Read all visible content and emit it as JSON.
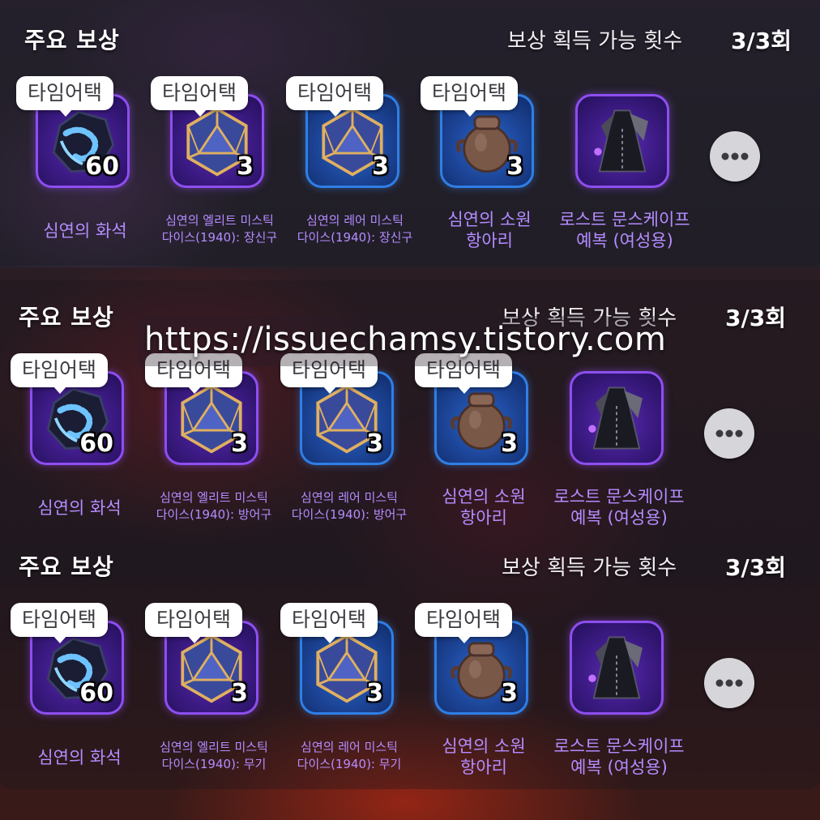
{
  "sections": [
    {
      "title": "주요 보상",
      "count_label": "보상 획득 가능 횟수",
      "count_value": "3/3회",
      "rewards": [
        {
          "badge": "타임어택",
          "quantity": "60",
          "name_lines": [
            "심연의 화석"
          ],
          "icon": "fossil-icon",
          "frame": "purple"
        },
        {
          "badge": "타임어택",
          "quantity": "3",
          "name_lines": [
            "심연의 엘리트 미스틱",
            "다이스(1940): 장신구"
          ],
          "icon": "dice-icon",
          "frame": "purple"
        },
        {
          "badge": "타임어택",
          "quantity": "3",
          "name_lines": [
            "심연의 레어 미스틱",
            "다이스(1940): 장신구"
          ],
          "icon": "dice-icon",
          "frame": "blue"
        },
        {
          "badge": "타임어택",
          "quantity": "3",
          "name_lines": [
            "심연의 소원",
            "항아리"
          ],
          "icon": "jar-icon",
          "frame": "blue"
        },
        {
          "badge": "",
          "quantity": "",
          "name_lines": [
            "로스트 문스케이프",
            "예복 (여성용)"
          ],
          "icon": "robe-icon",
          "frame": "purple"
        }
      ]
    },
    {
      "title": "주요 보상",
      "count_label": "보상 획득 가능 횟수",
      "count_value": "3/3회",
      "rewards": [
        {
          "badge": "타임어택",
          "quantity": "60",
          "name_lines": [
            "심연의 화석"
          ],
          "icon": "fossil-icon",
          "frame": "purple"
        },
        {
          "badge": "타임어택",
          "quantity": "3",
          "name_lines": [
            "심연의 엘리트 미스틱",
            "다이스(1940): 방어구"
          ],
          "icon": "dice-icon",
          "frame": "purple"
        },
        {
          "badge": "타임어택",
          "quantity": "3",
          "name_lines": [
            "심연의 레어 미스틱",
            "다이스(1940): 방어구"
          ],
          "icon": "dice-icon",
          "frame": "blue"
        },
        {
          "badge": "타임어택",
          "quantity": "3",
          "name_lines": [
            "심연의 소원",
            "항아리"
          ],
          "icon": "jar-icon",
          "frame": "blue"
        },
        {
          "badge": "",
          "quantity": "",
          "name_lines": [
            "로스트 문스케이프",
            "예복 (여성용)"
          ],
          "icon": "robe-icon",
          "frame": "purple"
        }
      ]
    },
    {
      "title": "주요 보상",
      "count_label": "보상 획득 가능 횟수",
      "count_value": "3/3회",
      "rewards": [
        {
          "badge": "타임어택",
          "quantity": "60",
          "name_lines": [
            "심연의 화석"
          ],
          "icon": "fossil-icon",
          "frame": "purple"
        },
        {
          "badge": "타임어택",
          "quantity": "3",
          "name_lines": [
            "심연의 엘리트 미스틱",
            "다이스(1940): 무기"
          ],
          "icon": "dice-icon",
          "frame": "purple"
        },
        {
          "badge": "타임어택",
          "quantity": "3",
          "name_lines": [
            "심연의 레어 미스틱",
            "다이스(1940): 무기"
          ],
          "icon": "dice-icon",
          "frame": "blue"
        },
        {
          "badge": "타임어택",
          "quantity": "3",
          "name_lines": [
            "심연의 소원",
            "항아리"
          ],
          "icon": "jar-icon",
          "frame": "blue"
        },
        {
          "badge": "",
          "quantity": "",
          "name_lines": [
            "로스트 문스케이프",
            "예복 (여성용)"
          ],
          "icon": "robe-icon",
          "frame": "purple"
        }
      ]
    }
  ],
  "more_button_icon": "more-dots-icon",
  "watermark": "https://issuechamsy.tistory.com",
  "colors": {
    "item_name": "#b58cff",
    "frame_purple": "#8e4ef0",
    "frame_blue": "#2f7fe6",
    "badge_bg": "#ffffff"
  }
}
